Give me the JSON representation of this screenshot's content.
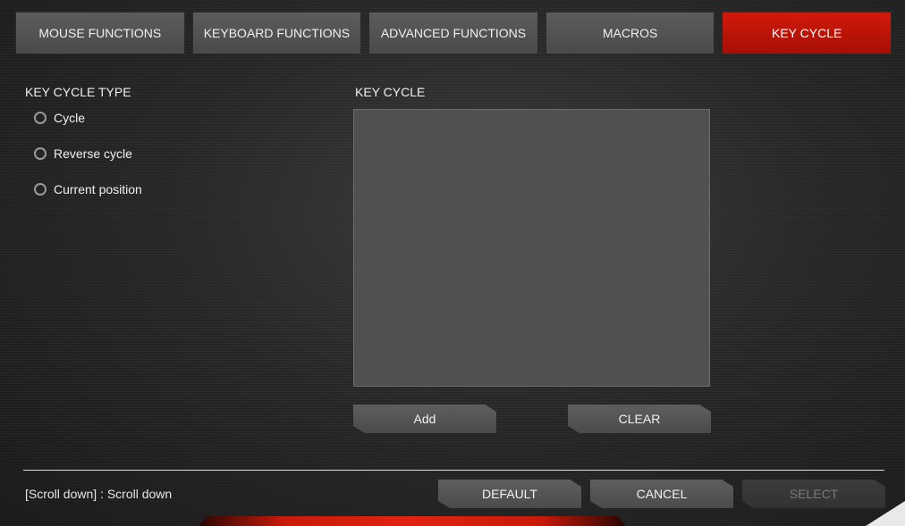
{
  "tabs": [
    {
      "label": "MOUSE FUNCTIONS"
    },
    {
      "label": "KEYBOARD FUNCTIONS"
    },
    {
      "label": "ADVANCED FUNCTIONS"
    },
    {
      "label": "MACROS"
    },
    {
      "label": "KEY CYCLE"
    }
  ],
  "active_tab": "KEY CYCLE",
  "key_cycle_type": {
    "title": "KEY CYCLE TYPE",
    "options": [
      {
        "label": "Cycle"
      },
      {
        "label": "Reverse cycle"
      },
      {
        "label": "Current position"
      }
    ]
  },
  "key_cycle": {
    "title": "KEY CYCLE",
    "add_label": "Add",
    "clear_label": "CLEAR"
  },
  "footer": {
    "hint": "[Scroll down] : Scroll down",
    "default_label": "DEFAULT",
    "cancel_label": "CANCEL",
    "select_label": "SELECT"
  },
  "colors": {
    "accent": "#c4140a",
    "tab_bg": "#555555",
    "list_bg": "#505050"
  }
}
